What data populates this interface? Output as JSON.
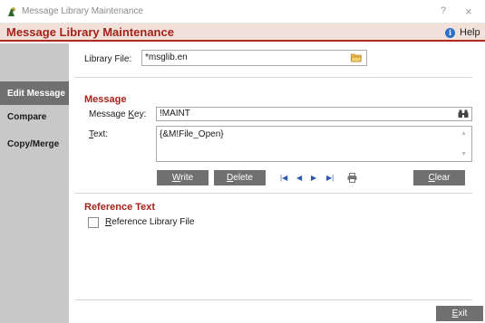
{
  "window": {
    "title": "Message Library Maintenance",
    "help_glyph": "?",
    "close_glyph": "×"
  },
  "header": {
    "title": "Message Library Maintenance",
    "help_label": "Help"
  },
  "sidebar": {
    "items": [
      {
        "label": "Edit  Message",
        "active": true
      },
      {
        "label": "Compare",
        "active": false
      },
      {
        "label": "Copy/Merge",
        "active": false
      }
    ]
  },
  "library": {
    "label": "Library File:",
    "value": "*msglib.en"
  },
  "message": {
    "section_title": "Message",
    "key_label_pre": "Message ",
    "key_label_ul": "K",
    "key_label_post": "ey:",
    "key_value": "!MAINT",
    "text_label_ul": "T",
    "text_label_post": "ext:",
    "text_value": "{&M!File_Open}"
  },
  "buttons": {
    "write_ul": "W",
    "write_rest": "rite",
    "delete_ul": "D",
    "delete_rest": "elete",
    "clear_ul": "C",
    "clear_rest": "lear",
    "exit_ul": "E",
    "exit_rest": "xit"
  },
  "reference": {
    "section_title": "Reference Text",
    "checkbox_ul": "R",
    "checkbox_rest": "eference Library File",
    "checked": false
  },
  "colors": {
    "accent_red": "#a3231a",
    "button_gray": "#707070",
    "sidebar_gray": "#c8c8c8",
    "nav_blue": "#2f5aa8"
  }
}
